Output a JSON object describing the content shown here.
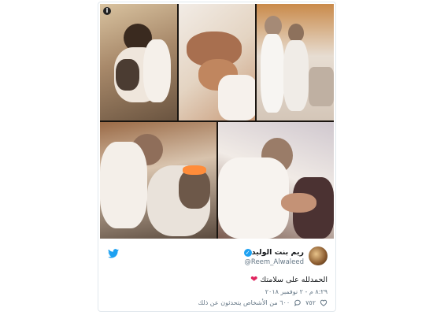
{
  "tweet": {
    "display_name": "ريم بنت الوليد",
    "handle": "@Reem_Alwaleed",
    "text": "الحمدلله على سلامتك",
    "timestamp": "٨:٢٩ م - ٢ نوفمبر ٢٠١٨",
    "like_count": "٧٥٢",
    "replies_text": "٦٠٠ من الأشخاص يتحدثون عن ذلك"
  },
  "colors": {
    "twitter_blue": "#1da1f2",
    "heart": "#e0245e",
    "muted": "#657786",
    "border": "#e1e8ed"
  },
  "icons": [
    "twitter-icon",
    "verified-icon",
    "heart-icon",
    "comment-icon",
    "info-icon",
    "red-heart-emoji"
  ]
}
